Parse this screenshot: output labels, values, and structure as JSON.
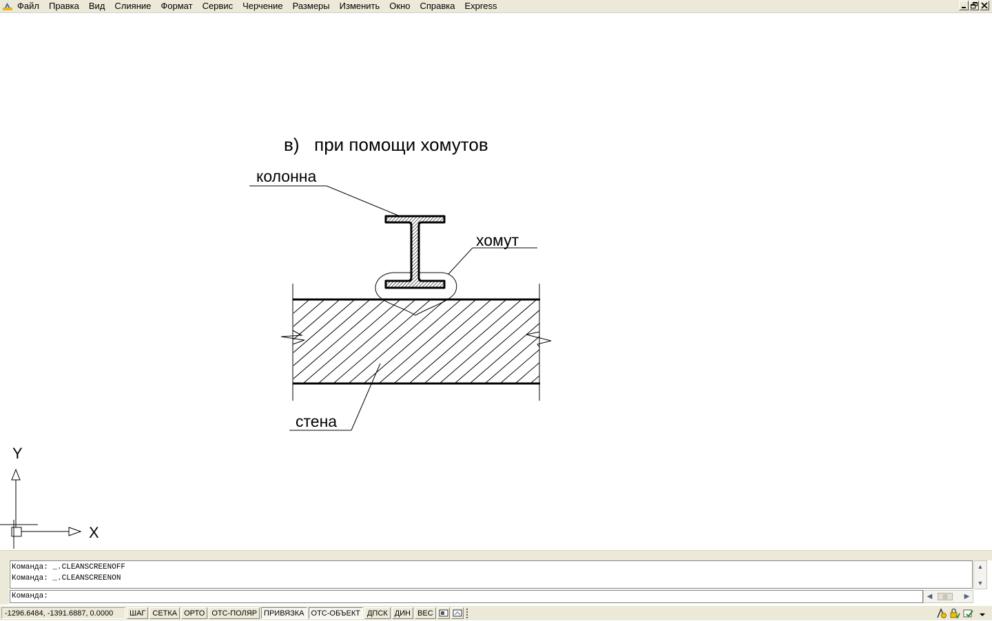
{
  "menu": [
    "Файл",
    "Правка",
    "Вид",
    "Слияние",
    "Формат",
    "Сервис",
    "Черчение",
    "Размеры",
    "Изменить",
    "Окно",
    "Справка",
    "Express"
  ],
  "drawing": {
    "title": "в)   при помощи хомутов",
    "label_column": "колонна",
    "label_clamp": "хомут",
    "label_wall": "стена",
    "ucs_y": "Y",
    "ucs_x": "X"
  },
  "command": {
    "history": [
      "Команда: _.CLEANSCREENOFF",
      "Команда: _.CLEANSCREENON"
    ],
    "prompt": "Команда:"
  },
  "status": {
    "coords": "-1296.6484, -1391.6887, 0.0000",
    "toggles": [
      {
        "label": "ШАГ",
        "on": false
      },
      {
        "label": "СЕТКА",
        "on": false
      },
      {
        "label": "ОРТО",
        "on": false
      },
      {
        "label": "ОТС-ПОЛЯР",
        "on": false
      },
      {
        "label": "ПРИВЯЗКА",
        "on": true
      },
      {
        "label": "ОТС-ОБЪЕКТ",
        "on": true
      },
      {
        "label": "ДПСК",
        "on": false
      },
      {
        "label": "ДИН",
        "on": false
      },
      {
        "label": "ВЕС",
        "on": false
      }
    ]
  },
  "colors": {
    "chrome": "#ece9d8",
    "canvas": "#ffffff",
    "ink": "#000000",
    "scroll_arrow": "#4d6185"
  },
  "icons": [
    "autocad-app-icon",
    "minimize-icon",
    "restore-icon",
    "close-icon",
    "model-icon",
    "layout-icon",
    "lock-icon",
    "tray-comm-icon",
    "tray-lock-icon",
    "tray-clean-icon",
    "menu-arrow-icon"
  ]
}
